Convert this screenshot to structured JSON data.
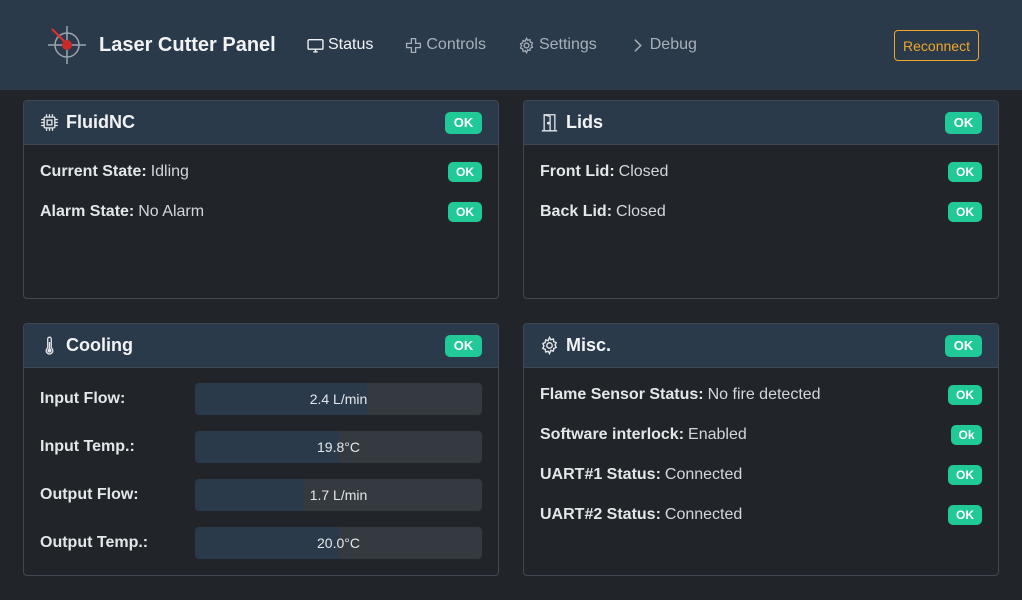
{
  "app": {
    "title": "Laser Cutter Panel"
  },
  "nav": {
    "status": "Status",
    "controls": "Controls",
    "settings": "Settings",
    "debug": "Debug",
    "reconnect": "Reconnect"
  },
  "colors": {
    "accent": "#20c997",
    "warning": "#f0a52a",
    "header_bg": "#2b3a4a",
    "page_bg": "#212529"
  },
  "fluidnc": {
    "title": "FluidNC",
    "badge": "OK",
    "rows": [
      {
        "label": "Current State:",
        "value": "Idling",
        "badge": "OK"
      },
      {
        "label": "Alarm State:",
        "value": "No Alarm",
        "badge": "OK"
      }
    ]
  },
  "lids": {
    "title": "Lids",
    "badge": "OK",
    "rows": [
      {
        "label": "Front Lid:",
        "value": "Closed",
        "badge": "OK"
      },
      {
        "label": "Back Lid:",
        "value": "Closed",
        "badge": "OK"
      }
    ]
  },
  "cooling": {
    "title": "Cooling",
    "badge": "OK",
    "meters": [
      {
        "label": "Input Flow:",
        "text": "2.4 L/min",
        "fraction": 0.6
      },
      {
        "label": "Input Temp.:",
        "text": "19.8°C",
        "fraction": 0.5
      },
      {
        "label": "Output Flow:",
        "text": "1.7 L/min",
        "fraction": 0.38
      },
      {
        "label": "Output Temp.:",
        "text": "20.0°C",
        "fraction": 0.5
      }
    ]
  },
  "misc": {
    "title": "Misc.",
    "badge": "OK",
    "rows": [
      {
        "label": "Flame Sensor Status:",
        "value": "No fire detected",
        "badge": "OK"
      },
      {
        "label": "Software interlock:",
        "value": "Enabled",
        "badge": "Ok"
      },
      {
        "label": "UART#1 Status:",
        "value": "Connected",
        "badge": "OK"
      },
      {
        "label": "UART#2 Status:",
        "value": "Connected",
        "badge": "OK"
      }
    ]
  }
}
